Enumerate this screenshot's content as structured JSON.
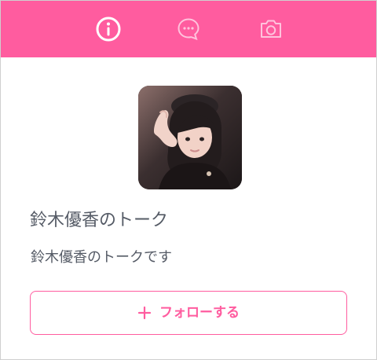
{
  "colors": {
    "accent": "#ff5c9f",
    "text": "#555b66",
    "background": "#ffffff"
  },
  "tabs": [
    {
      "icon": "info-icon",
      "selected": true
    },
    {
      "icon": "chat-bubble-icon",
      "selected": false
    },
    {
      "icon": "camera-icon",
      "selected": false
    }
  ],
  "profile": {
    "avatar_icon": "profile-photo",
    "title": "鈴木優香のトーク",
    "description": "鈴木優香のトークです"
  },
  "follow_button": {
    "icon": "plus-icon",
    "label": "フォローする"
  }
}
